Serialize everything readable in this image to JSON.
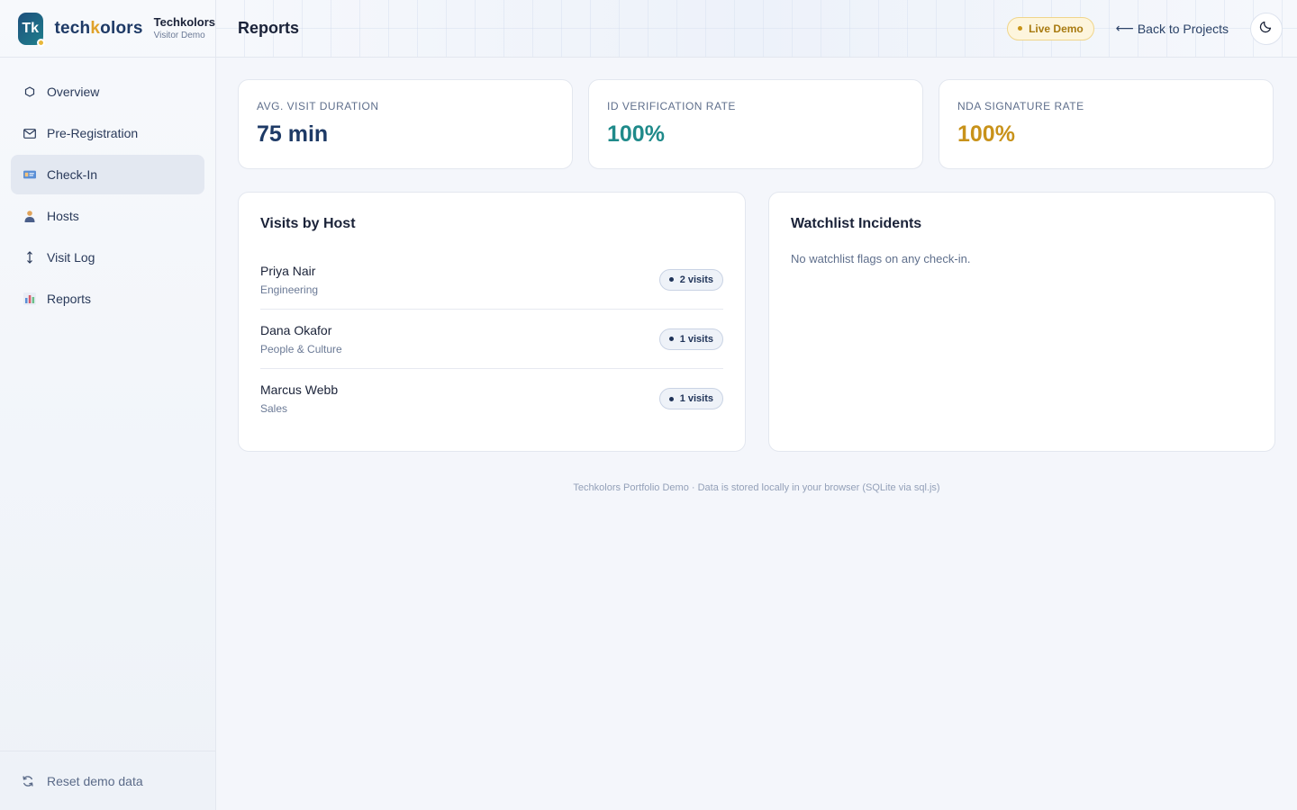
{
  "brand": {
    "logo_text": "Tk",
    "wordmark_pre": "tech",
    "wordmark_k": "k",
    "wordmark_post": "olors",
    "company": "Techkolors",
    "subtitle": "Visitor Demo"
  },
  "sidebar": {
    "items": [
      {
        "label": "Overview",
        "icon": "hexagon-icon",
        "active": false
      },
      {
        "label": "Pre-Registration",
        "icon": "envelope-icon",
        "active": false
      },
      {
        "label": "Check-In",
        "icon": "id-card-icon",
        "active": true
      },
      {
        "label": "Hosts",
        "icon": "person-icon",
        "active": false
      },
      {
        "label": "Visit Log",
        "icon": "up-down-arrow-icon",
        "active": false
      },
      {
        "label": "Reports",
        "icon": "bar-chart-icon",
        "active": false
      }
    ],
    "footer_label": "Reset demo data"
  },
  "header": {
    "title": "Reports",
    "live_badge": "Live Demo",
    "back_arrow": "⟵",
    "back_label": "Back to Projects"
  },
  "stats": [
    {
      "label": "AVG. VISIT DURATION",
      "value": "75 min",
      "color": "#1e3a66"
    },
    {
      "label": "ID VERIFICATION RATE",
      "value": "100%",
      "color": "#1f8a8a"
    },
    {
      "label": "NDA SIGNATURE RATE",
      "value": "100%",
      "color": "#c8921a"
    }
  ],
  "visits_by_host": {
    "title": "Visits by Host",
    "rows": [
      {
        "name": "Priya Nair",
        "dept": "Engineering",
        "visits": "2 visits"
      },
      {
        "name": "Dana Okafor",
        "dept": "People & Culture",
        "visits": "1 visits"
      },
      {
        "name": "Marcus Webb",
        "dept": "Sales",
        "visits": "1 visits"
      }
    ]
  },
  "watchlist": {
    "title": "Watchlist Incidents",
    "empty_text": "No watchlist flags on any check-in."
  },
  "footer_note": "Techkolors Portfolio Demo · Data is stored locally in your browser (SQLite via sql.js)"
}
